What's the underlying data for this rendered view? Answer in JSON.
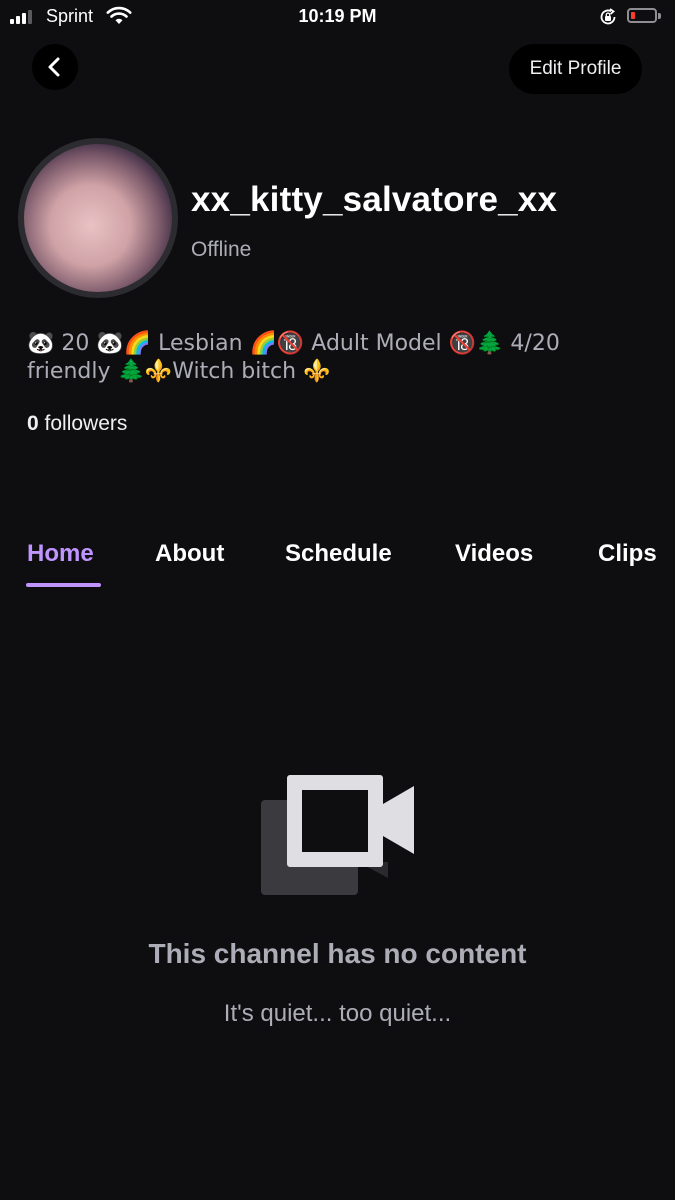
{
  "status_bar": {
    "carrier": "Sprint",
    "time": "10:19 PM",
    "battery_level": 0.1,
    "signal_bars": 3,
    "icons": [
      "signal-icon",
      "wifi-icon",
      "rotation-lock-icon",
      "battery-icon"
    ]
  },
  "header": {
    "back_icon": "chevron-left-icon",
    "edit_label": "Edit Profile"
  },
  "profile": {
    "username": "xx_kitty_salvatore_xx",
    "status": "Offline",
    "bio": "🐼 20 🐼🌈 Lesbian 🌈🔞 Adult Model 🔞🌲 4/20 friendly 🌲⚜️Witch bitch ⚜️",
    "followers_count": "0",
    "followers_label": "followers"
  },
  "tabs": [
    {
      "label": "Home",
      "active": true
    },
    {
      "label": "About",
      "active": false
    },
    {
      "label": "Schedule",
      "active": false
    },
    {
      "label": "Videos",
      "active": false
    },
    {
      "label": "Clips",
      "active": false
    }
  ],
  "empty_state": {
    "icon": "video-camera-icon",
    "title": "This channel has no content",
    "subtitle": "It's quiet... too quiet..."
  },
  "colors": {
    "background": "#0e0e10",
    "accent": "#bf94ff",
    "muted_text": "#adadb8"
  }
}
